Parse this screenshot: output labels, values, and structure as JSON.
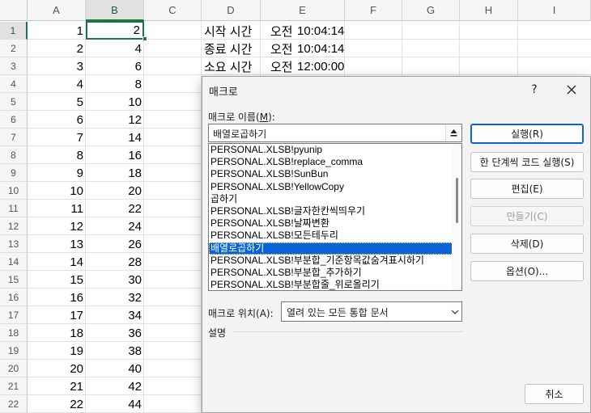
{
  "sheet": {
    "columns": [
      "A",
      "B",
      "C",
      "D",
      "E",
      "F",
      "G",
      "H",
      "I"
    ],
    "rows": [
      "1",
      "2",
      "3",
      "4",
      "5",
      "6",
      "7",
      "8",
      "9",
      "10",
      "11",
      "12",
      "13",
      "14",
      "15",
      "16",
      "17",
      "18",
      "19",
      "20",
      "21",
      "22"
    ],
    "col_a": [
      "1",
      "2",
      "3",
      "4",
      "5",
      "6",
      "7",
      "8",
      "9",
      "10",
      "11",
      "12",
      "13",
      "14",
      "15",
      "16",
      "17",
      "18",
      "19",
      "20",
      "21",
      "22"
    ],
    "col_b": [
      "2",
      "4",
      "6",
      "8",
      "10",
      "12",
      "14",
      "16",
      "18",
      "20",
      "22",
      "24",
      "26",
      "28",
      "30",
      "32",
      "34",
      "36",
      "38",
      "40",
      "42",
      "44"
    ],
    "info": [
      {
        "label": "시작 시간",
        "ampm": "오전",
        "time": "10:04:14"
      },
      {
        "label": "종료 시간",
        "ampm": "오전",
        "time": "10:04:14"
      },
      {
        "label": "소요 시간",
        "ampm": "오전",
        "time": "12:00:00"
      }
    ]
  },
  "dialog": {
    "title": "매크로",
    "help": "?",
    "name_label": "매크로 이름(",
    "name_label_key": "M",
    "name_label_end": "):",
    "name_value": "배열로곱하기",
    "macros": [
      "PERSONAL.XLSB!pyunip",
      "PERSONAL.XLSB!replace_comma",
      "PERSONAL.XLSB!SunBun",
      "PERSONAL.XLSB!YellowCopy",
      "곱하기",
      "PERSONAL.XLSB!글자한칸씩띄우기",
      "PERSONAL.XLSB!날짜변환",
      "PERSONAL.XLSB!모든테두리",
      "배열로곱하기",
      "PERSONAL.XLSB!부분합_기준항목값숨겨표시하기",
      "PERSONAL.XLSB!부분합_추가하기",
      "PERSONAL.XLSB!부분합줄_위로올리기"
    ],
    "selected_macro": "배열로곱하기",
    "buttons": {
      "run": "실행(R)",
      "step": "한 단계씩 코드 실행(S)",
      "edit": "편집(E)",
      "create": "만들기(C)",
      "delete": "삭제(D)",
      "options": "옵션(O)..."
    },
    "location_label": "매크로 위치(A):",
    "location_value": "열려 있는 모든 통합 문서",
    "description_label": "설명",
    "cancel": "취소"
  }
}
